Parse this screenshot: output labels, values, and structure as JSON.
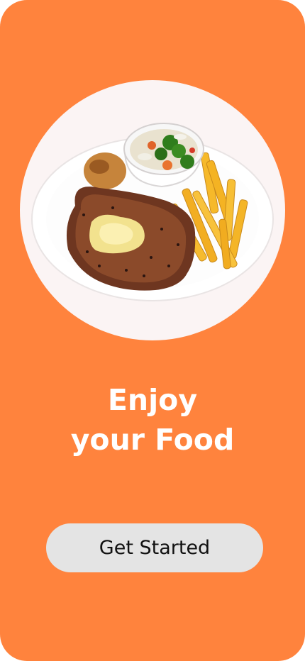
{
  "onboarding": {
    "hero_image": "steak-plate-image",
    "headline_line1": "Enjoy",
    "headline_line2": "your Food",
    "cta_label": "Get Started"
  },
  "colors": {
    "background": "#ff833d",
    "plate_circle": "#fbf4f4",
    "headline_text": "#ffffff",
    "button_bg": "#e4e4e4",
    "button_text": "#111111"
  }
}
